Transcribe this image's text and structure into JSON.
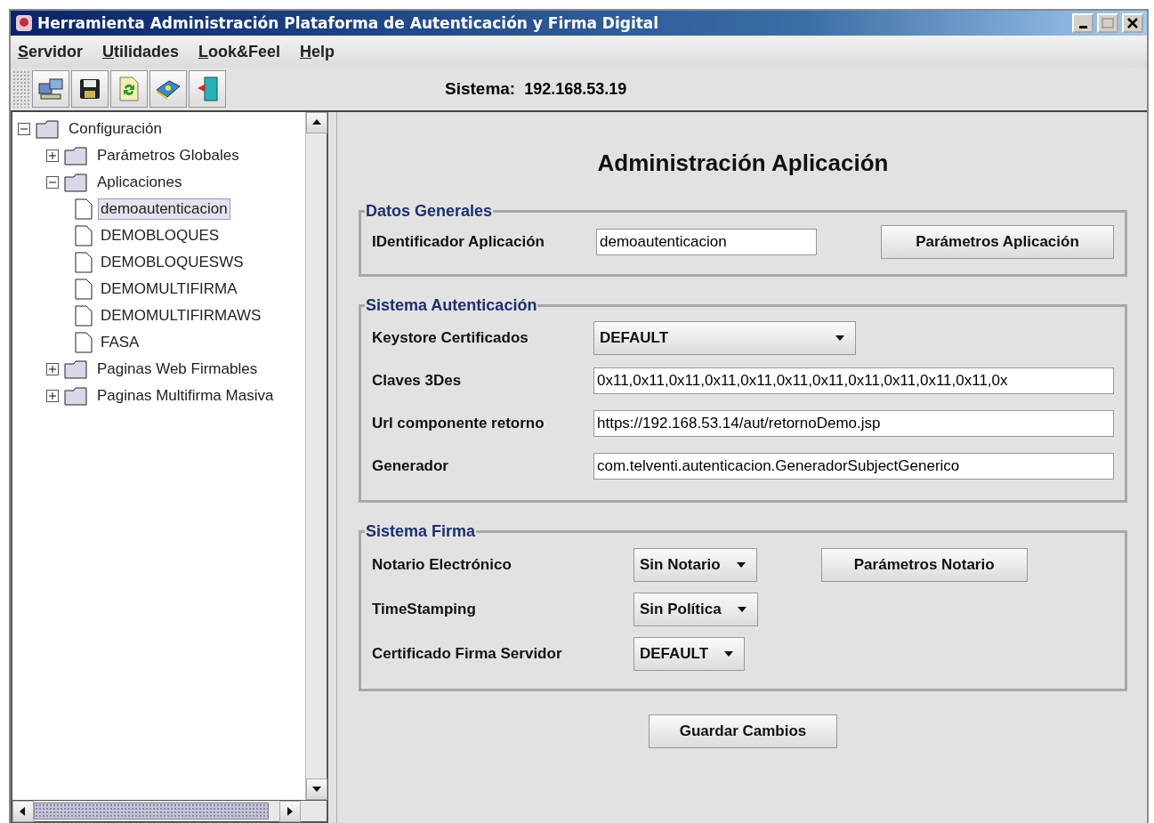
{
  "window": {
    "title": "Herramienta Administración Plataforma de Autenticación y Firma Digital"
  },
  "menu": [
    {
      "label": "Servidor"
    },
    {
      "label": "Utilidades"
    },
    {
      "label": "Look&Feel"
    },
    {
      "label": "Help"
    }
  ],
  "toolbar": {
    "buttons": [
      {
        "kind": "computer"
      },
      {
        "kind": "floppy"
      },
      {
        "kind": "refresh"
      },
      {
        "kind": "book"
      },
      {
        "kind": "door"
      }
    ],
    "system_label": "Sistema:",
    "system_value": "192.168.53.19"
  },
  "tree": [
    {
      "label": "Configuración",
      "kind": "folder",
      "expanded": true,
      "selected": false,
      "children": [
        {
          "label": "Parámetros Globales",
          "kind": "folder",
          "expanded": false,
          "selected": false
        },
        {
          "label": "Aplicaciones",
          "kind": "folder",
          "expanded": true,
          "selected": false,
          "children": [
            {
              "label": "demoautenticacion",
              "kind": "file",
              "selected": true
            },
            {
              "label": "DEMOBLOQUES",
              "kind": "file",
              "selected": false
            },
            {
              "label": "DEMOBLOQUESWS",
              "kind": "file",
              "selected": false
            },
            {
              "label": "DEMOMULTIFIRMA",
              "kind": "file",
              "selected": false
            },
            {
              "label": "DEMOMULTIFIRMAWS",
              "kind": "file",
              "selected": false
            },
            {
              "label": "FASA",
              "kind": "file",
              "selected": false
            }
          ]
        },
        {
          "label": "Paginas Web Firmables",
          "kind": "folder",
          "expanded": false,
          "selected": false
        },
        {
          "label": "Paginas Multifirma Masiva",
          "kind": "folder",
          "expanded": false,
          "selected": false
        }
      ]
    }
  ],
  "panel": {
    "title": "Administración Aplicación",
    "sections": [
      {
        "title": "Datos Generales",
        "rows": [
          {
            "label": "IDentificador Aplicación",
            "kind": "text",
            "value": "demoautenticacion",
            "button": "Parámetros Aplicación"
          }
        ]
      },
      {
        "title": "Sistema Autenticación",
        "rows": [
          {
            "label": "Keystore Certificados",
            "kind": "select",
            "value": "DEFAULT"
          },
          {
            "label": "Claves 3Des",
            "kind": "text",
            "value": "0x11,0x11,0x11,0x11,0x11,0x11,0x11,0x11,0x11,0x11,0x11,0x"
          },
          {
            "label": "Url componente retorno",
            "kind": "text",
            "value": "https://192.168.53.14/aut/retornoDemo.jsp"
          },
          {
            "label": "Generador",
            "kind": "text",
            "value": "com.telventi.autenticacion.GeneradorSubjectGenerico"
          }
        ]
      },
      {
        "title": "Sistema Firma",
        "rows": [
          {
            "label": "Notario Electrónico",
            "kind": "select",
            "value": "Sin Notario",
            "button": "Parámetros Notario"
          },
          {
            "label": "TimeStamping",
            "kind": "select",
            "value": "Sin Política"
          },
          {
            "label": "Certificado Firma Servidor",
            "kind": "select",
            "value": "DEFAULT"
          }
        ]
      }
    ],
    "save_button": "Guardar Cambios"
  }
}
